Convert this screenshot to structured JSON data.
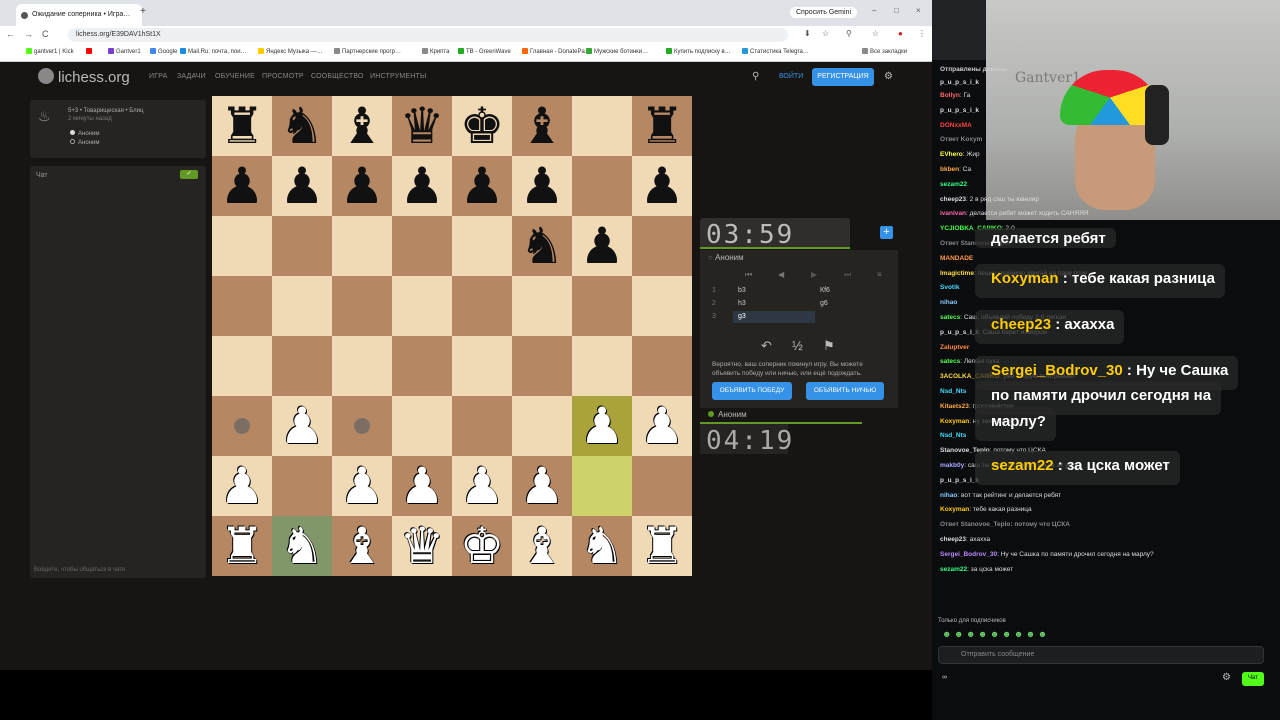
{
  "browser": {
    "tab_title": "Ожидание соперника • Игра…",
    "new_tab": "+",
    "gemini": "Спросить Gemini",
    "win_controls": [
      "–",
      "□",
      "×"
    ],
    "nav": [
      "←",
      "→",
      "C"
    ],
    "url": "lichess.org/E39DAV1hSt1X",
    "right_icons": [
      "⬇",
      "☆",
      "⚲",
      "☆",
      "●",
      "⋮"
    ],
    "bookmarks": [
      {
        "label": "gantver1 | Kick",
        "color": "#53fc18"
      },
      {
        "label": "",
        "color": "#f00"
      },
      {
        "label": "Gantver1",
        "color": "#7b3fd6"
      },
      {
        "label": "Google",
        "color": "#4285f4"
      },
      {
        "label": "Mail.Ru: почта, пои…",
        "color": "#168de2"
      },
      {
        "label": "Яндекс Музыка —…",
        "color": "#fc0"
      },
      {
        "label": "Партнерские прогр…",
        "color": "#888"
      },
      {
        "label": "Крипта",
        "color": "#888"
      },
      {
        "label": "TB - GreenWave",
        "color": "#2a2"
      },
      {
        "label": "Главная - DonatePa…",
        "color": "#f60"
      },
      {
        "label": "Мужские ботинки…",
        "color": "#3a3"
      },
      {
        "label": "Купить подписку в…",
        "color": "#2a2"
      },
      {
        "label": "Статистика Telegra…",
        "color": "#29d"
      },
      {
        "label": "Все закладки",
        "color": "#888"
      }
    ]
  },
  "lichess": {
    "logo": "lichess.org",
    "menu": [
      "ИГРА",
      "ЗАДАЧИ",
      "ОБУЧЕНИЕ",
      "ПРОСМОТР",
      "СООБЩЕСТВО",
      "ИНСТРУМЕНТЫ"
    ],
    "login": "ВОЙТИ",
    "signup": "РЕГИСТРАЦИЯ",
    "game": {
      "title": "5+3 • Товарищеская • Блиц",
      "since": "2 минуты назад",
      "players": [
        "Аноним",
        "Аноним"
      ]
    },
    "chat": {
      "title": "Чат",
      "hint": "Войдите, чтобы общаться в чате",
      "toggle": "✓"
    },
    "board": [
      [
        "♜",
        "♞",
        "♝",
        "♛",
        "♚",
        "♝",
        "",
        "♜"
      ],
      [
        "♟",
        "♟",
        "♟",
        "♟",
        "♟",
        "♟",
        "",
        "♟"
      ],
      [
        "",
        "",
        "",
        "",
        "",
        "♞",
        "♟",
        ""
      ],
      [
        "",
        "",
        "",
        "",
        "",
        "",
        "",
        ""
      ],
      [
        "",
        "",
        "",
        "",
        "",
        "",
        "",
        ""
      ],
      [
        "",
        "♙",
        "",
        "",
        "",
        "",
        "♙",
        "♙"
      ],
      [
        "♙",
        "",
        "♙",
        "♙",
        "♙",
        "♙",
        "",
        ""
      ],
      [
        "♖",
        "♘",
        "♗",
        "♕",
        "♔",
        "♗",
        "♘",
        "♖"
      ]
    ],
    "clock_top": "03:59",
    "clock_bottom": "04:19",
    "player_top": "Аноним",
    "player_bottom": "Аноним",
    "moves": [
      {
        "n": "1",
        "w": "b3",
        "b": "Кf6"
      },
      {
        "n": "2",
        "w": "h3",
        "b": "g6"
      },
      {
        "n": "3",
        "w": "g3",
        "b": ""
      }
    ],
    "move_controls": [
      "⏮",
      "◀",
      "▶",
      "⏭",
      "≡"
    ],
    "actions": [
      "↶",
      "½",
      "⚑"
    ],
    "message": "Вероятно, ваш соперник покинул игру. Вы можете объявить победу или ничью, или ещё подождать.",
    "claim_win": "ОБЪЯВИТЬ ПОБЕДУ",
    "claim_draw": "ОБЪЯВИТЬ НИЧЬЮ",
    "plus": "+"
  },
  "stream": {
    "cam_text": "Gantver1",
    "chat": [
      {
        "user": "Отправлены донаты",
        "color": "#ccc",
        "text": ""
      },
      {
        "user": "p_u_p_s_i_k",
        "color": "#ddd",
        "text": ""
      },
      {
        "user": "Bollyn",
        "color": "#f66",
        "text": "Га"
      },
      {
        "user": "p_u_p_s_i_k",
        "color": "#ddd",
        "text": ""
      },
      {
        "user": "DONxxMA",
        "color": "#f44",
        "text": ""
      },
      {
        "user": "Ответ Koxym",
        "color": "#888",
        "text": ""
      },
      {
        "user": "EVhero",
        "color": "#ff4",
        "text": "Жир"
      },
      {
        "user": "bkben",
        "color": "#fa4",
        "text": "Са"
      },
      {
        "user": "sezam22",
        "color": "#3f8",
        "text": ""
      },
      {
        "user": "cheep23",
        "color": "#ddd",
        "text": "2 в ряд саш ты ювелир"
      },
      {
        "user": "ivanivan",
        "color": "#f6a",
        "text": "делается ребят   может ходить САНЯЯЯ"
      },
      {
        "user": "YCJIOBKA_CAIIIKO",
        "color": "#4f4",
        "text": "2-0"
      },
      {
        "user": "Ответ Stanovoe_Teplo",
        "color": "#888",
        "text": ""
      },
      {
        "user": "MANDADE",
        "color": "#f94",
        "text": ""
      },
      {
        "user": "Imagictime",
        "color": "#fd4",
        "text": "пешку крайнюю двигай на пару позу"
      },
      {
        "user": "Svotik",
        "color": "#4df",
        "text": ""
      },
      {
        "user": "nihao",
        "color": "#8cf",
        "text": ""
      },
      {
        "user": "satecs",
        "color": "#5f5",
        "text": "Саш, объявляй победу 2-0 легкая"
      },
      {
        "user": "p_u_p_s_i_k",
        "color": "#ddd",
        "text": "Саша берет измором"
      },
      {
        "user": "Zaluptver",
        "color": "#f84",
        "text": ""
      },
      {
        "user": "satecs",
        "color": "#5f5",
        "text": "Легкая сука"
      },
      {
        "user": "3ACOLKA_CAIIIKO",
        "color": "#fd4",
        "text": "уже вторую выигрывает"
      },
      {
        "user": "Nsd_Nts",
        "color": "#4df",
        "text": ""
      },
      {
        "user": "Kitaets23",
        "color": "#fa4",
        "text": "гроссмейстер"
      },
      {
        "user": "Koxyman",
        "color": "#fc0",
        "text": "ну захотел чё"
      },
      {
        "user": "Nsd_Nts",
        "color": "#4df",
        "text": ""
      },
      {
        "user": "Stanovoe_Teplo",
        "color": "#ddd",
        "text": "потому что ЦСКА"
      },
      {
        "user": "makb0y",
        "color": "#aaf",
        "text": "саш ты неор  играешь типы в ах уе )))"
      },
      {
        "user": "p_u_p_s_i_k",
        "color": "#ddd",
        "text": ""
      },
      {
        "user": "nihao",
        "color": "#8cf",
        "text": "вот так рейтинг и делается ребят"
      },
      {
        "user": "Koxyman",
        "color": "#fc0",
        "text": "тебе какая разница"
      },
      {
        "user": "Ответ Stanovoe_Teplo: потому что ЦСКА",
        "color": "#888",
        "text": ""
      },
      {
        "user": "cheep23",
        "color": "#ddd",
        "text": "ахахха"
      },
      {
        "user": "Sergei_Bodrov_30",
        "color": "#b8f",
        "text": "Ну че Сашка по памяти дрочил сегодня на марлу?"
      },
      {
        "user": "sezam22",
        "color": "#3f8",
        "text": "за цска может"
      }
    ],
    "overlay": [
      {
        "user": "Koxyman",
        "text": "тебе какая разница"
      },
      {
        "user": "cheep23",
        "text": "ахахха"
      },
      {
        "user": "Sergei_Bodrov_30",
        "text": "Ну че Сашка"
      },
      {
        "user": "",
        "text": "по памяти дрочил сегодня на"
      },
      {
        "user": "",
        "text": "марлу?"
      },
      {
        "user": "sezam22",
        "text": "за цска может"
      }
    ],
    "overlay_header": "делается ребят",
    "sub_only": "Только для подписчиков",
    "emotes": "☻ ☻ ☻ ☻ ☻ ☻ ☻ ☻ ☻",
    "input_placeholder": "Отправить сообщение",
    "chat_button": "Чат",
    "viewers": "∞"
  }
}
